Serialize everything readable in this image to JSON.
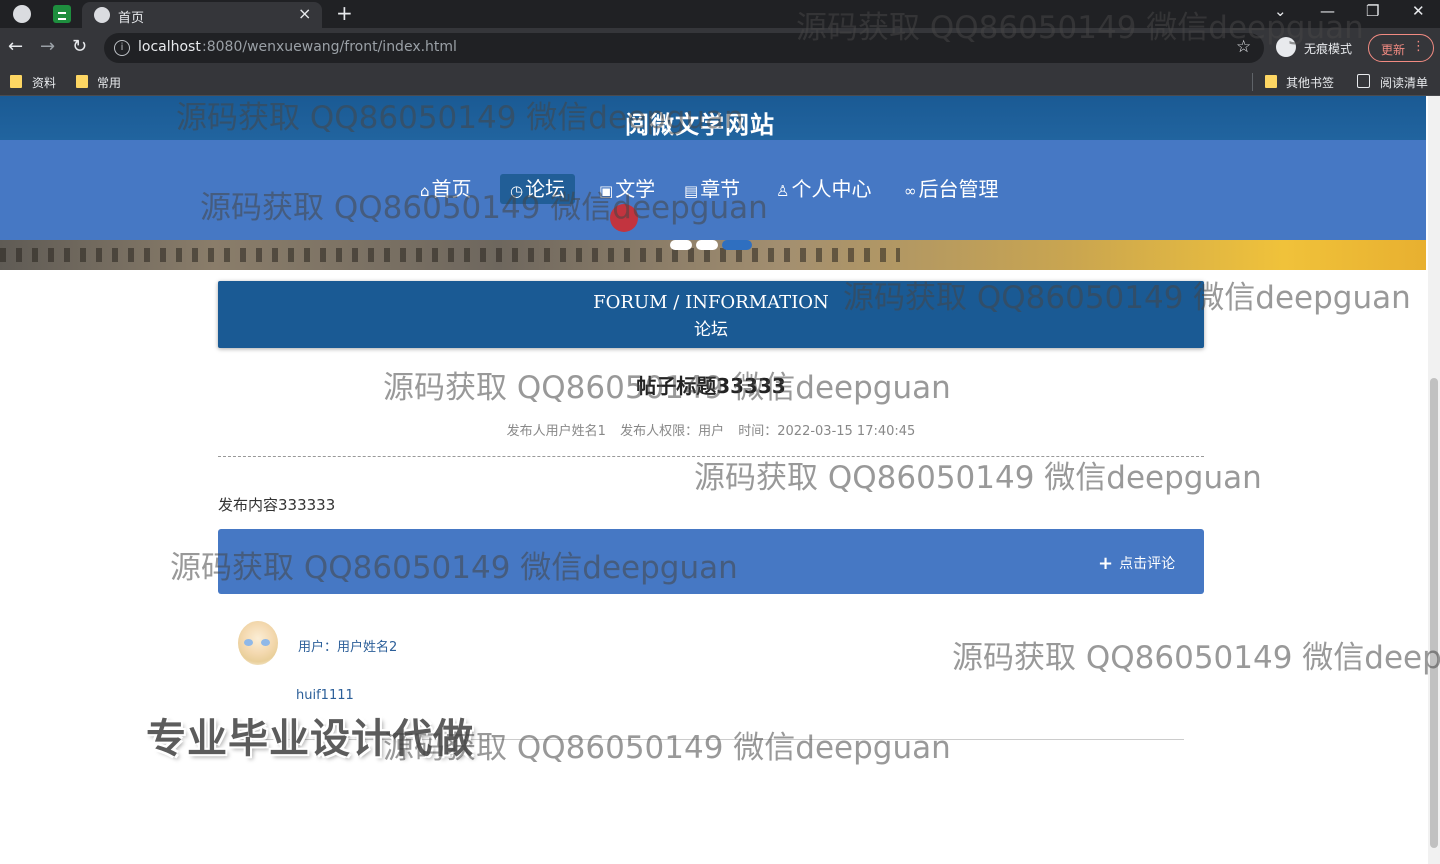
{
  "browser": {
    "tab_title": "首页",
    "url_host": "localhost",
    "url_rest": ":8080/wenxuewang/front/index.html",
    "incognito_label": "无痕模式",
    "update_label": "更新",
    "bookmarks": [
      "资料",
      "常用"
    ],
    "bookmarks_right": [
      "其他书签",
      "阅读清单"
    ]
  },
  "site": {
    "title": "阅微文学网站",
    "nav": [
      {
        "label": "首页",
        "icon": "home-icon"
      },
      {
        "label": "论坛",
        "icon": "forum-icon"
      },
      {
        "label": "文学",
        "icon": "book-icon"
      },
      {
        "label": "章节",
        "icon": "chapter-icon"
      },
      {
        "label": "个人中心",
        "icon": "user-icon"
      },
      {
        "label": "后台管理",
        "icon": "link-icon"
      }
    ],
    "active_nav": "论坛"
  },
  "section": {
    "title_en": "FORUM / INFORMATION",
    "title_cn": "论坛"
  },
  "post": {
    "title": "帖子标题33333",
    "author": "发布人用户姓名1",
    "role": "发布人权限：用户",
    "time": "时间：2022-03-15 17:40:45",
    "content": "发布内容333333"
  },
  "comment_button": "点击评论",
  "comments": [
    {
      "user": "用户：用户姓名2",
      "text": "huif1111"
    }
  ],
  "watermark_text": "源码获取 QQ86050149 微信deepguan",
  "promo_text": "专业毕业设计代做",
  "colors": {
    "header": "#1a5a94",
    "nav": "#4678c4",
    "active_nav": "#215e97",
    "comment_bar": "#4678c4"
  }
}
